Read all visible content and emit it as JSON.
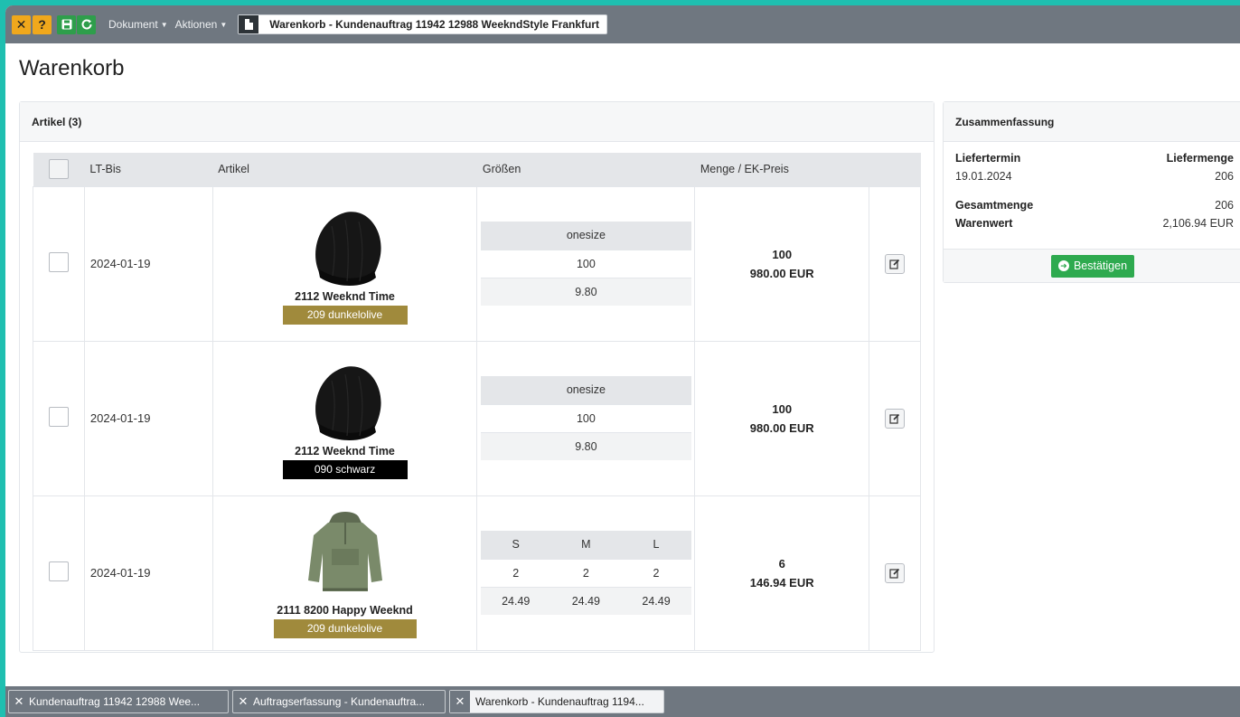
{
  "toolbar": {
    "close_icon": "x-icon",
    "help_icon": "question-icon",
    "save_icon": "save-icon",
    "refresh_icon": "refresh-icon",
    "menu_document": "Dokument",
    "menu_actions": "Aktionen",
    "window_title": "Warenkorb - Kundenauftrag 11942 12988 WeekndStyle Frankfurt"
  },
  "page": {
    "title": "Warenkorb"
  },
  "articles": {
    "header": "Artikel (3)",
    "columns": [
      "LT-Bis",
      "Artikel",
      "Größen",
      "Menge / EK-Preis"
    ],
    "rows": [
      {
        "date": "2024-01-19",
        "article": "2112 Weeknd Time",
        "color": "209 dunkelolive",
        "color_hex": "#a08a3c",
        "sizes": [
          "onesize"
        ],
        "quantities": [
          "100"
        ],
        "prices": [
          "9.80"
        ],
        "qty": "100",
        "total": "980.00 EUR"
      },
      {
        "date": "2024-01-19",
        "article": "2112 Weeknd Time",
        "color": "090 schwarz",
        "color_hex": "#000000",
        "sizes": [
          "onesize"
        ],
        "quantities": [
          "100"
        ],
        "prices": [
          "9.80"
        ],
        "qty": "100",
        "total": "980.00 EUR"
      },
      {
        "date": "2024-01-19",
        "article": "2111 8200 Happy Weeknd",
        "color": "209 dunkelolive",
        "color_hex": "#a08a3c",
        "sizes": [
          "S",
          "M",
          "L"
        ],
        "quantities": [
          "2",
          "2",
          "2"
        ],
        "prices": [
          "24.49",
          "24.49",
          "24.49"
        ],
        "qty": "6",
        "total": "146.94 EUR"
      }
    ]
  },
  "summary": {
    "header": "Zusammenfassung",
    "delivery_date_label": "Liefertermin",
    "delivery_qty_label": "Liefermenge",
    "delivery_date": "19.01.2024",
    "delivery_qty": "206",
    "total_qty_label": "Gesamtmenge",
    "total_qty": "206",
    "goods_value_label": "Warenwert",
    "goods_value": "2,106.94 EUR",
    "confirm_label": "Bestätigen"
  },
  "bottom_tabs": [
    {
      "label": "Kundenauftrag 11942 12988 Wee...",
      "active": false
    },
    {
      "label": "Auftragserfassung - Kundenauftra...",
      "active": false
    },
    {
      "label": "Warenkorb - Kundenauftrag 1194...",
      "active": true
    }
  ],
  "colors": {
    "toolbar_bg": "#6f7780",
    "accent_green": "#2eaa4f",
    "accent_yellow": "#f0a81c",
    "frame_teal": "#1fbfb0"
  }
}
